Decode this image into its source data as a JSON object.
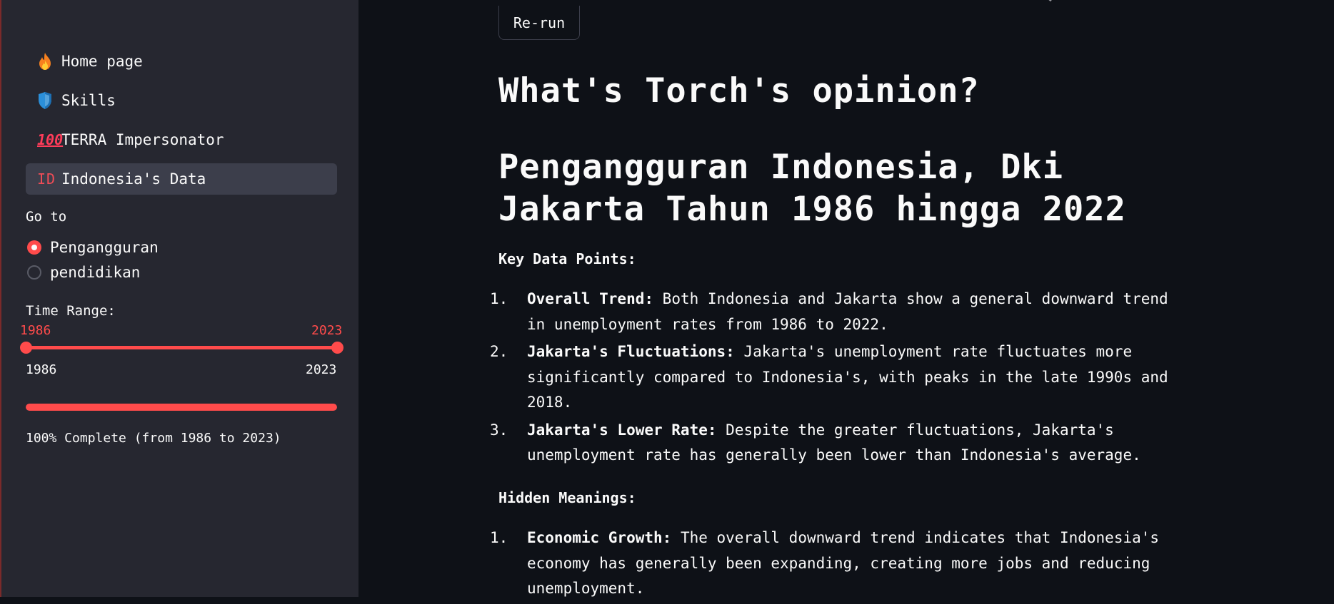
{
  "sidebar": {
    "nav": [
      {
        "label": "Home page",
        "icon": "fire-icon"
      },
      {
        "label": "Skills",
        "icon": "shield-icon"
      },
      {
        "label": "TERRA Impersonator",
        "icon": "hundred-points-icon",
        "icon_text": "100"
      },
      {
        "label": "Indonesia's Data",
        "icon": "id-flag-icon",
        "icon_text": "ID",
        "active": true
      }
    ],
    "goto_label": "Go to",
    "radio_options": [
      {
        "label": "Pengangguran",
        "selected": true
      },
      {
        "label": "pendidikan",
        "selected": false
      }
    ],
    "time_range": {
      "label": "Time Range:",
      "selected_start": "1986",
      "selected_end": "2023",
      "min": "1986",
      "max": "2023"
    },
    "progress": {
      "percent": 100,
      "text": "100% Complete (from 1986 to 2023)"
    }
  },
  "main": {
    "rerun_label": "Re-run",
    "title": "What's Torch's opinion?",
    "chart_title_line1": "Pengangguran Indonesia, Dki",
    "chart_title_line2": "Jakarta Tahun 1986 hingga 2022",
    "key_points_heading": "Key Data Points:",
    "key_points": [
      {
        "num": "1.",
        "bold": "Overall Trend:",
        "lines": [
          "Both Indonesia and Jakarta show a general downward trend",
          "in unemployment rates from 1986 to 2022."
        ]
      },
      {
        "num": "2.",
        "bold": "Jakarta's Fluctuations:",
        "lines": [
          "Jakarta's unemployment rate fluctuates more",
          "significantly compared to Indonesia's, with peaks in the late 1990s and",
          "2018."
        ]
      },
      {
        "num": "3.",
        "bold": "Jakarta's Lower Rate:",
        "lines": [
          "Despite the greater fluctuations, Jakarta's",
          "unemployment rate has generally been lower than Indonesia's average."
        ]
      }
    ],
    "hidden_heading": "Hidden Meanings:",
    "hidden_points": [
      {
        "num": "1.",
        "bold": "Economic Growth:",
        "lines": [
          "The overall downward trend indicates that Indonesia's",
          "economy has generally been expanding, creating more jobs and reducing",
          "unemployment."
        ]
      }
    ]
  },
  "colors": {
    "background": "#0e1117",
    "sidebar": "#262730",
    "accent": "#ff4b4b",
    "text": "#fafafa"
  }
}
